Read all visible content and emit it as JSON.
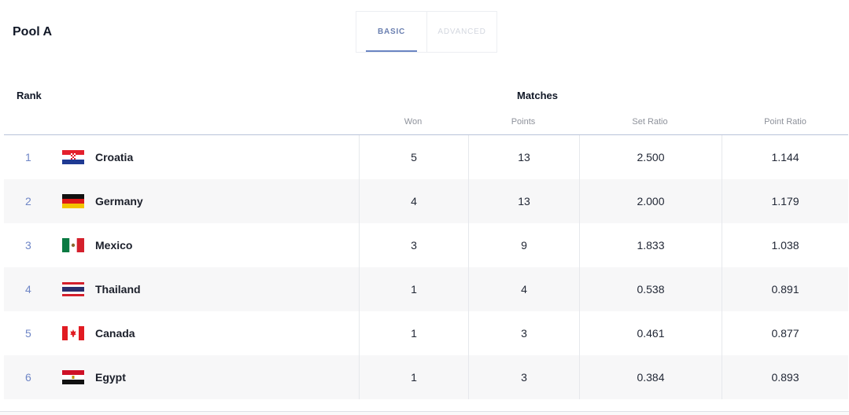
{
  "pool": {
    "title": "Pool A"
  },
  "tabs": [
    {
      "label": "BASIC",
      "active": true
    },
    {
      "label": "ADVANCED",
      "active": false
    }
  ],
  "headers": {
    "rank": "Rank",
    "matches": "Matches",
    "columns": [
      "Won",
      "Points",
      "Set Ratio",
      "Point Ratio"
    ]
  },
  "rows": [
    {
      "rank": "1",
      "team": "Croatia",
      "flag": "croatia-flag-icon",
      "won": "5",
      "points": "13",
      "set_ratio": "2.500",
      "point_ratio": "1.144"
    },
    {
      "rank": "2",
      "team": "Germany",
      "flag": "germany-flag-icon",
      "won": "4",
      "points": "13",
      "set_ratio": "2.000",
      "point_ratio": "1.179"
    },
    {
      "rank": "3",
      "team": "Mexico",
      "flag": "mexico-flag-icon",
      "won": "3",
      "points": "9",
      "set_ratio": "1.833",
      "point_ratio": "1.038"
    },
    {
      "rank": "4",
      "team": "Thailand",
      "flag": "thailand-flag-icon",
      "won": "1",
      "points": "4",
      "set_ratio": "0.538",
      "point_ratio": "0.891"
    },
    {
      "rank": "5",
      "team": "Canada",
      "flag": "canada-flag-icon",
      "won": "1",
      "points": "3",
      "set_ratio": "0.461",
      "point_ratio": "0.877"
    },
    {
      "rank": "6",
      "team": "Egypt",
      "flag": "egypt-flag-icon",
      "won": "1",
      "points": "3",
      "set_ratio": "0.384",
      "point_ratio": "0.893"
    }
  ],
  "colors": {
    "accent": "#6a85c2",
    "rank_text": "#6f86c6",
    "alt_row": "#f7f7f8"
  }
}
